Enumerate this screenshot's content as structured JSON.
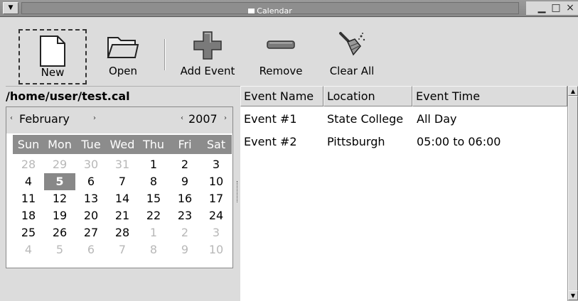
{
  "window": {
    "title": "Calendar",
    "menu_glyph": "▼",
    "minimize_glyph": "▁",
    "maximize_glyph": "□",
    "close_glyph": "×"
  },
  "toolbar": {
    "new_label": "New",
    "open_label": "Open",
    "add_label": "Add Event",
    "remove_label": "Remove",
    "clear_label": "Clear All"
  },
  "path": "/home/user/test.cal",
  "calendar": {
    "month": "February",
    "year": "2007",
    "prev_glyph": "‹",
    "next_glyph": "›",
    "day_names": [
      "Sun",
      "Mon",
      "Tue",
      "Wed",
      "Thu",
      "Fri",
      "Sat"
    ],
    "weeks": [
      [
        "28",
        "29",
        "30",
        "31",
        "1",
        "2",
        "3"
      ],
      [
        "4",
        "5",
        "6",
        "7",
        "8",
        "9",
        "10"
      ],
      [
        "11",
        "12",
        "13",
        "14",
        "15",
        "16",
        "17"
      ],
      [
        "18",
        "19",
        "20",
        "21",
        "22",
        "23",
        "24"
      ],
      [
        "25",
        "26",
        "27",
        "28",
        "1",
        "2",
        "3"
      ],
      [
        "4",
        "5",
        "6",
        "7",
        "8",
        "9",
        "10"
      ]
    ],
    "selected_day": "5"
  },
  "events": {
    "columns": [
      "Event Name",
      "Location",
      "Event Time"
    ],
    "rows": [
      [
        "Event #1",
        "State College",
        "All Day"
      ],
      [
        "Event #2",
        "Pittsburgh",
        "05:00 to 06:00"
      ]
    ]
  },
  "scrollbar": {
    "up_glyph": "▲",
    "down_glyph": "▼"
  }
}
